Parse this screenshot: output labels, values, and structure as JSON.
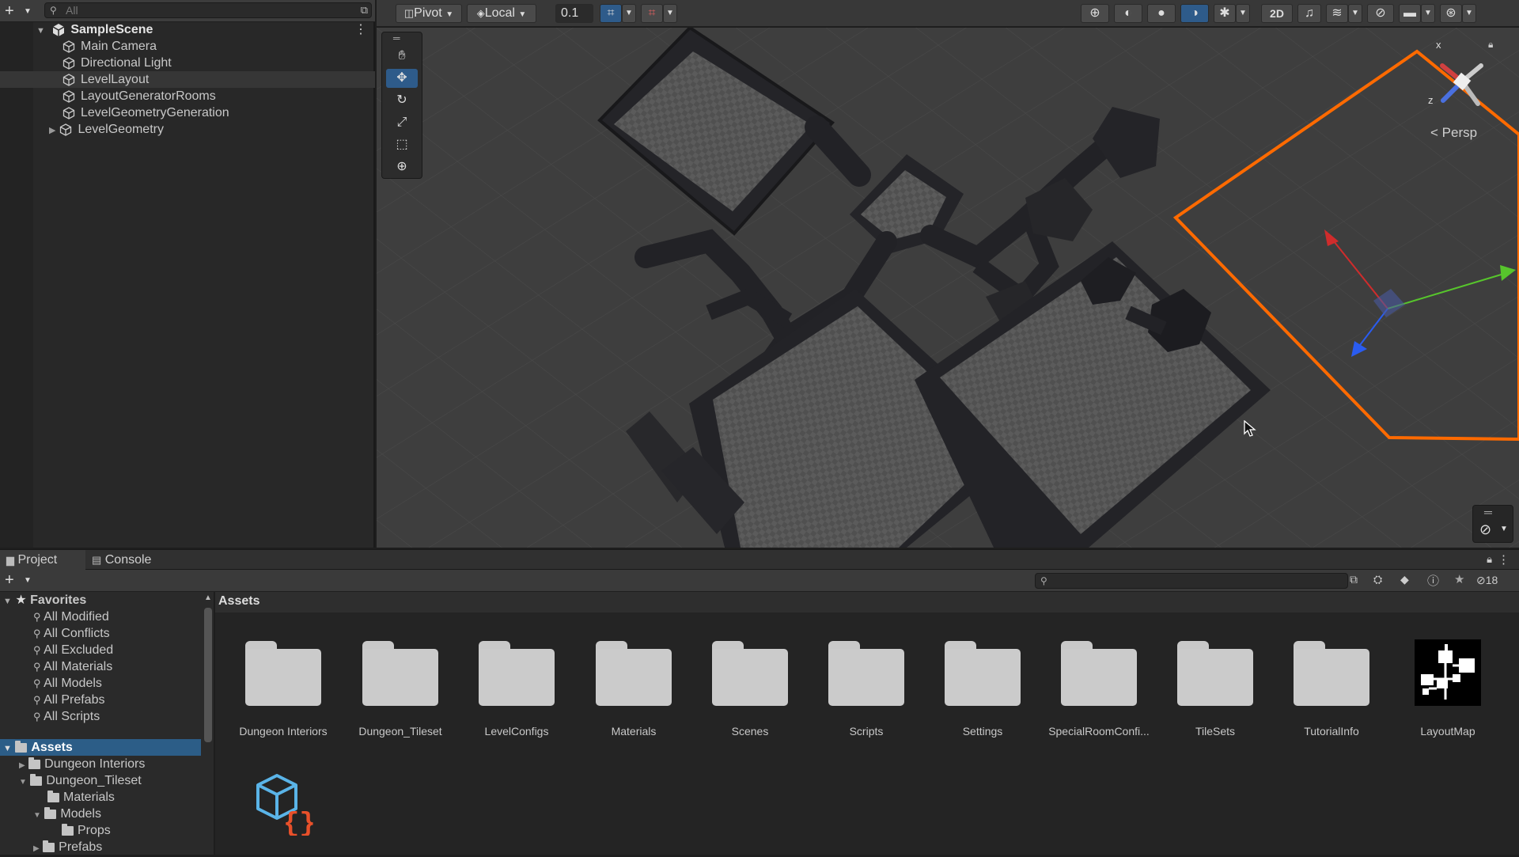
{
  "hierarchy": {
    "search_placeholder": "All",
    "scene_name": "SampleScene",
    "items": [
      {
        "label": "Main Camera"
      },
      {
        "label": "Directional Light"
      },
      {
        "label": "LevelLayout"
      },
      {
        "label": "LayoutGeneratorRooms"
      },
      {
        "label": "LevelGeometryGeneration"
      },
      {
        "label": "LevelGeometry"
      }
    ]
  },
  "scene_toolbar": {
    "pivot_label": "Pivot",
    "space_label": "Local",
    "snap_value": "0.1",
    "mode_2d_label": "2D"
  },
  "scene_view": {
    "persp_label": "Persp",
    "gizmo_x": "x",
    "gizmo_z": "z"
  },
  "project": {
    "tab_project": "Project",
    "tab_console": "Console",
    "hidden_count": "18",
    "breadcrumb": "Assets",
    "tree": {
      "favorites_label": "Favorites",
      "favorites": [
        "All Modified",
        "All Conflicts",
        "All Excluded",
        "All Materials",
        "All Models",
        "All Prefabs",
        "All Scripts"
      ],
      "assets_label": "Assets",
      "folders": [
        {
          "label": "Dungeon Interiors"
        },
        {
          "label": "Dungeon_Tileset"
        },
        {
          "label": "Materials"
        },
        {
          "label": "Models"
        },
        {
          "label": "Props"
        },
        {
          "label": "Prefabs"
        }
      ]
    },
    "assets": [
      "Dungeon Interiors",
      "Dungeon_Tileset",
      "LevelConfigs",
      "Materials",
      "Scenes",
      "Scripts",
      "Settings",
      "SpecialRoomConfi...",
      "TileSets",
      "TutorialInfo",
      "LayoutMap"
    ]
  },
  "colors": {
    "selection_blue": "#2c5d87",
    "selection_orange": "#ff6a00",
    "axis_red": "#d02c2c",
    "axis_green": "#57c52c",
    "axis_blue": "#2a5cf0"
  }
}
